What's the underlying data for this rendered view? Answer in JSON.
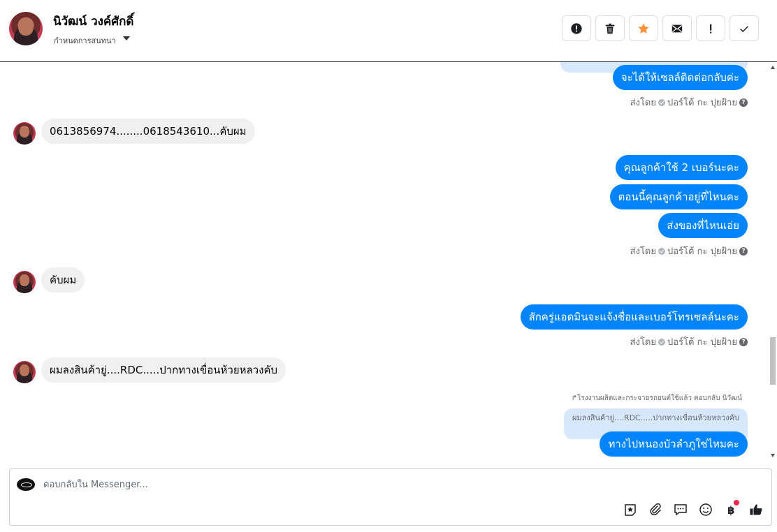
{
  "header": {
    "contact_name": "นิวัฒน์ วงค์ศักดิ์",
    "assign_label": "กำหนดการสนทนา"
  },
  "toolbar": {
    "buttons": [
      "alert-icon",
      "trash-icon",
      "star-icon",
      "envelope-icon",
      "exclamation-icon",
      "checkmark-icon"
    ],
    "star_color": "#f7923a"
  },
  "thread": {
    "messages": [
      {
        "side": "out",
        "text": "จะได้ให้เซลล์ติดต่อกลับค่ะ"
      },
      {
        "side": "sent_by",
        "prefix": "ส่งโดย",
        "agent": "ปอร์โต้ กะ ปุยฝ้าย"
      },
      {
        "side": "in",
        "text": "0613856974........0618543610...คับผม"
      },
      {
        "side": "out",
        "text": "คุณลูกค้าใช้ 2 เบอร์นะคะ"
      },
      {
        "side": "out",
        "text": "ตอนนี้คุณลูกค้าอยู่ที่ไหนคะ"
      },
      {
        "side": "out",
        "text": "ส่งของที่ไหนเอ่ย"
      },
      {
        "side": "sent_by",
        "prefix": "ส่งโดย",
        "agent": "ปอร์โต้ กะ ปุยฝ้าย"
      },
      {
        "side": "in",
        "text": "คับผม"
      },
      {
        "side": "out",
        "text": "สักครู่แอดมินจะแจ้งชื่อและเบอร์โทรเซลล์นะคะ"
      },
      {
        "side": "sent_by",
        "prefix": "ส่งโดย",
        "agent": "ปอร์โต้ กะ ปุยฝ้าย"
      },
      {
        "side": "in",
        "text": "ผมลงสินค้ายู่....RDC.....ปากทางเขื่อนห้วยหลวงคับ"
      },
      {
        "side": "reply_note",
        "text": "โรงงานผลิตและกระจายรถยนต์ใช้แล้ว ตอบกลับ นิวัฒน์"
      },
      {
        "side": "quoted",
        "text": "ผมลงสินค้ายู่....RDC.....ปากทางเขื่อนห้วยหลวงคับ"
      },
      {
        "side": "out",
        "text": "ทางไปหนองบัวลำภูใช่ไหมคะ"
      }
    ]
  },
  "composer": {
    "placeholder": "ตอบกลับใน Messenger...",
    "icons": [
      "sticker-star-icon",
      "paperclip-icon",
      "saved-reply-icon",
      "emoji-icon",
      "baht-payment-icon",
      "thumbs-up-icon"
    ]
  },
  "colors": {
    "accent": "#0084ff",
    "incoming_bubble": "#f0f0f0",
    "quoted_bubble": "#d7e8fd"
  }
}
